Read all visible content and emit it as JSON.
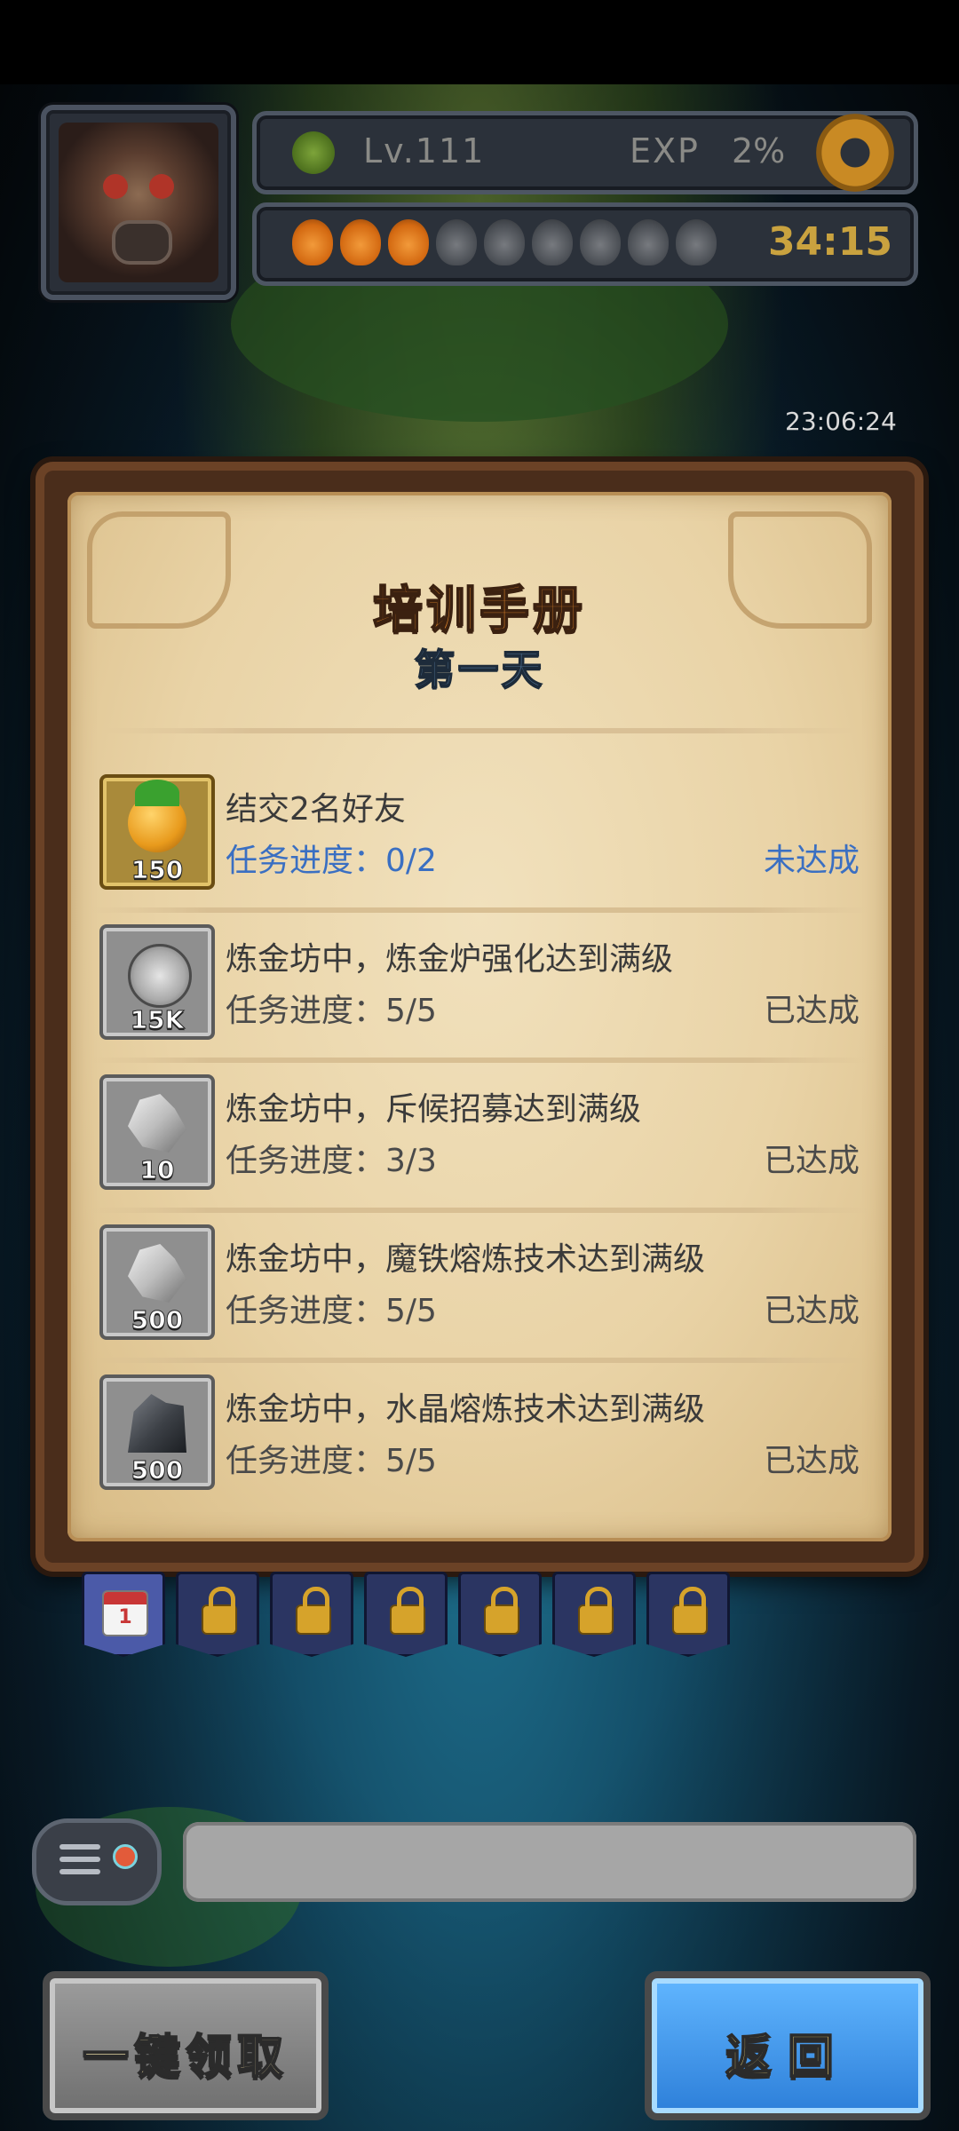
{
  "hud": {
    "level": "Lv.111",
    "exp_label": "EXP",
    "exp_value": "2%",
    "energy": {
      "filled": 3,
      "total": 9
    },
    "timer": "34:15",
    "clock": "23:06:24"
  },
  "dialog": {
    "title": "培训手册",
    "subtitle": "第一天",
    "tasks": [
      {
        "reward_qty": "150",
        "text": "结交2名好友",
        "progress": "任务进度：0/2",
        "status": "未达成"
      },
      {
        "reward_qty": "15K",
        "text": "炼金坊中，炼金炉强化达到满级",
        "progress": "任务进度：5/5",
        "status": "已达成"
      },
      {
        "reward_qty": "10",
        "text": "炼金坊中，斥候招募达到满级",
        "progress": "任务进度：3/3",
        "status": "已达成"
      },
      {
        "reward_qty": "500",
        "text": "炼金坊中，魔铁熔炼技术达到满级",
        "progress": "任务进度：5/5",
        "status": "已达成"
      },
      {
        "reward_qty": "500",
        "text": "炼金坊中，水晶熔炼技术达到满级",
        "progress": "任务进度：5/5",
        "status": "已达成"
      }
    ]
  },
  "day_tabs": {
    "active_day_number": "1"
  },
  "buttons": {
    "claim_all": "一键领取",
    "back": "返回"
  },
  "colors": {
    "pending": "#3a6fc2",
    "done": "#4a4a4a"
  }
}
